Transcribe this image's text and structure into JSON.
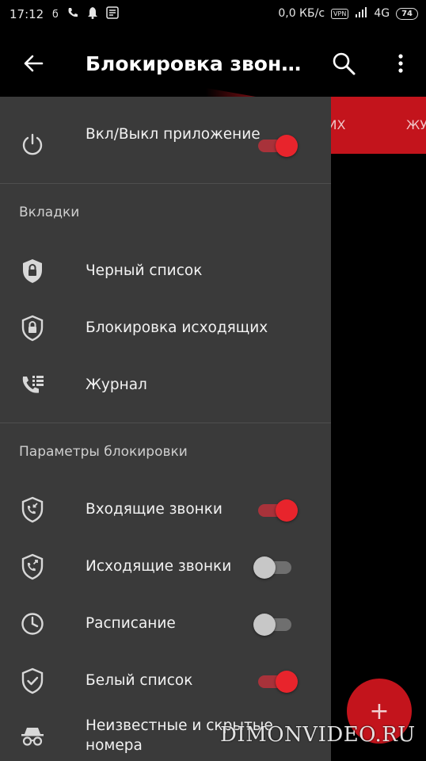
{
  "status_bar": {
    "time": "17:12",
    "network_speed": "0,0 КБ/с",
    "vpn": "VPN",
    "network_type": "4G",
    "battery": "74"
  },
  "app_bar": {
    "title": "Блокировка звон…",
    "back_icon": "arrow-left-icon",
    "search_icon": "search-icon",
    "more_icon": "more-vert-icon"
  },
  "background_tabs": {
    "outgoing_partial": "ЩИХ",
    "log_partial": "ЖУ"
  },
  "drawer": {
    "app_toggle": {
      "label": "Вкл/Выкл приложение",
      "on": true
    },
    "tabs_section": {
      "title": "Вкладки",
      "items": [
        {
          "label": "Черный список",
          "icon": "shield-lock-icon"
        },
        {
          "label": "Блокировка исходящих",
          "icon": "shield-lock-icon"
        },
        {
          "label": "Журнал",
          "icon": "call-log-icon"
        }
      ]
    },
    "params_section": {
      "title": "Параметры блокировки",
      "items": [
        {
          "label": "Входящие звонки",
          "icon": "shield-incoming-call-icon",
          "on": true
        },
        {
          "label": "Исходящие звонки",
          "icon": "shield-outgoing-call-icon",
          "on": false
        },
        {
          "label": "Расписание",
          "icon": "clock-icon",
          "on": false
        },
        {
          "label": "Белый список",
          "icon": "shield-check-icon",
          "on": true
        },
        {
          "label": "Неизвестные и скрытые номера",
          "icon": "incognito-icon"
        }
      ]
    }
  },
  "fab": {
    "label": "+"
  },
  "watermark": "DIMONVIDEO.RU",
  "colors": {
    "accent": "#e8242c",
    "drawer_bg": "#3a3a3a",
    "appbar_bg": "#000000",
    "tab_red": "#c3141c"
  }
}
